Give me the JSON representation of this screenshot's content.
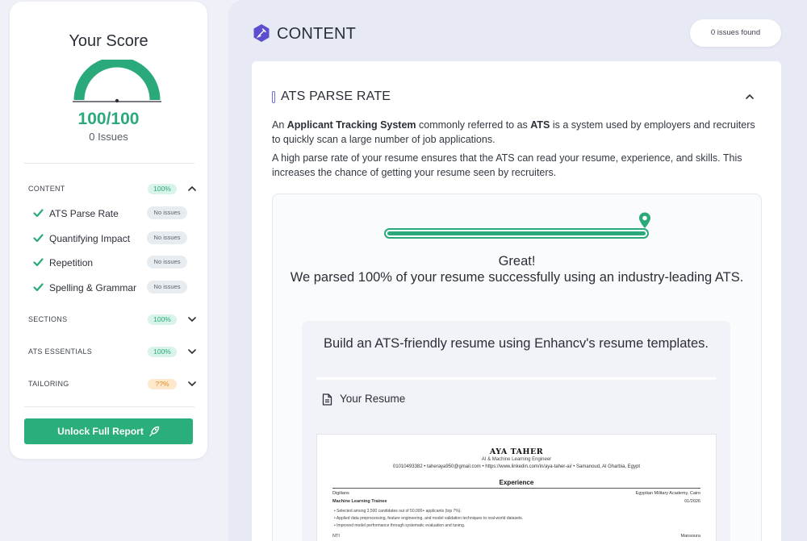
{
  "sidebar": {
    "score_title": "Your Score",
    "score_value": "100/100",
    "score_issues": "0 Issues",
    "score_fraction": 1.0,
    "categories": [
      {
        "label": "CONTENT",
        "badge": "100%",
        "expanded": true,
        "items": [
          {
            "label": "ATS Parse Rate",
            "status": "No issues"
          },
          {
            "label": "Quantifying Impact",
            "status": "No issues"
          },
          {
            "label": "Repetition",
            "status": "No issues"
          },
          {
            "label": "Spelling & Grammar",
            "status": "No issues"
          }
        ]
      },
      {
        "label": "SECTIONS",
        "badge": "100%",
        "expanded": false
      },
      {
        "label": "ATS ESSENTIALS",
        "badge": "100%",
        "expanded": false
      },
      {
        "label": "TAILORING",
        "badge": "??%",
        "expanded": false
      }
    ],
    "unlock_label": "Unlock Full Report"
  },
  "main": {
    "section_title": "CONTENT",
    "issues_found": "0 issues found",
    "ats": {
      "title": "ATS PARSE RATE",
      "para1_pre": "An ",
      "para1_b1": "Applicant Tracking System",
      "para1_mid": " commonly referred to as ",
      "para1_b2": "ATS",
      "para1_post": " is a system used by employers and recruiters to quickly scan a large number of job applications.",
      "para2": "A high parse rate of your resume ensures that the ATS can read your resume, experience, and skills. This increases the chance of getting your resume seen by recruiters.",
      "parse_progress": 1.0,
      "great": "Great!",
      "message": "We parsed 100% of your resume successfully using an industry-leading ATS.",
      "build_text": "Build an ATS-friendly resume using Enhancv's resume templates.",
      "your_resume": "Your Resume"
    },
    "resume": {
      "name": "AYA TAHER",
      "role": "AI & Machine Learning Engineer",
      "contact": "01010493382  •  taheraya950@gmail.com  •  https://www.linkedin.com/in/aya-taher-ai/  •  Samanoud, Al Gharbia, Egypt",
      "section": "Experience",
      "company": "Digilians",
      "location": "Egyptian Military Academy, Cairo",
      "title": "Machine Learning Trainee",
      "date": "01/2026",
      "bullets": [
        "Selected among 3,500 candidates out of 50,000+ applicants (top 7%).",
        "Applied data preprocessing, feature engineering, and model validation techniques to real-world datasets.",
        "Improved model performance through systematic evaluation and tuning."
      ],
      "next_company": "NTI",
      "next_location": "Mansoura"
    }
  },
  "colors": {
    "accent_green": "#2aa97b",
    "warn_orange": "#e08a1e",
    "badge_green_bg": "#d8f3e8",
    "section_icon_purple": "#5b4fcf"
  }
}
